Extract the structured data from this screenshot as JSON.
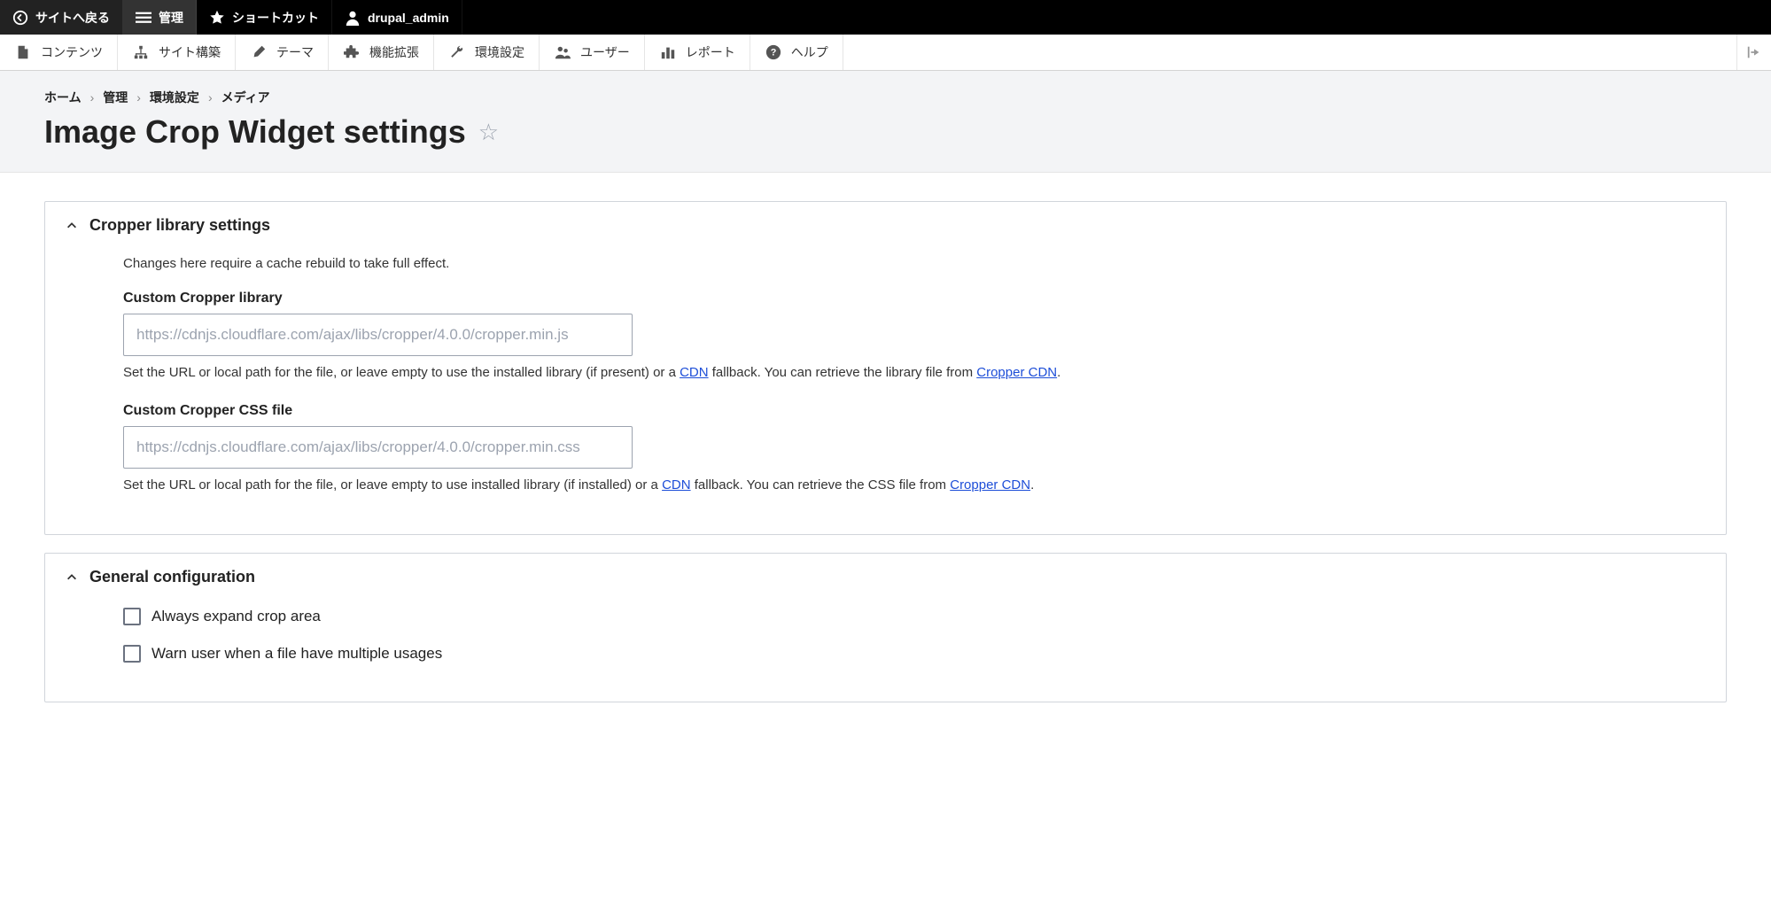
{
  "topbar": {
    "back_label": "サイトへ戻る",
    "manage_label": "管理",
    "shortcuts_label": "ショートカット",
    "user_label": "drupal_admin"
  },
  "secondbar": {
    "content": "コンテンツ",
    "structure": "サイト構築",
    "appearance": "テーマ",
    "extend": "機能拡張",
    "config": "環境設定",
    "people": "ユーザー",
    "reports": "レポート",
    "help": "ヘルプ"
  },
  "breadcrumb": {
    "home": "ホーム",
    "admin": "管理",
    "config": "環境設定",
    "media": "メディア"
  },
  "page_title": "Image Crop Widget settings",
  "panel1": {
    "title": "Cropper library settings",
    "note": "Changes here require a cache rebuild to take full effect.",
    "lib_label": "Custom Cropper library",
    "lib_placeholder": "https://cdnjs.cloudflare.com/ajax/libs/cropper/4.0.0/cropper.min.js",
    "lib_desc_pre": "Set the URL or local path for the file, or leave empty to use the installed library (if present) or a ",
    "lib_desc_link1": "CDN",
    "lib_desc_mid": " fallback. You can retrieve the library file from ",
    "lib_desc_link2": "Cropper CDN",
    "lib_desc_post": ".",
    "css_label": "Custom Cropper CSS file",
    "css_placeholder": "https://cdnjs.cloudflare.com/ajax/libs/cropper/4.0.0/cropper.min.css",
    "css_desc_pre": "Set the URL or local path for the file, or leave empty to use installed library (if installed) or a ",
    "css_desc_link1": "CDN",
    "css_desc_mid": " fallback. You can retrieve the CSS file from ",
    "css_desc_link2": "Cropper CDN",
    "css_desc_post": "."
  },
  "panel2": {
    "title": "General configuration",
    "cb1": "Always expand crop area",
    "cb2": "Warn user when a file have multiple usages"
  }
}
